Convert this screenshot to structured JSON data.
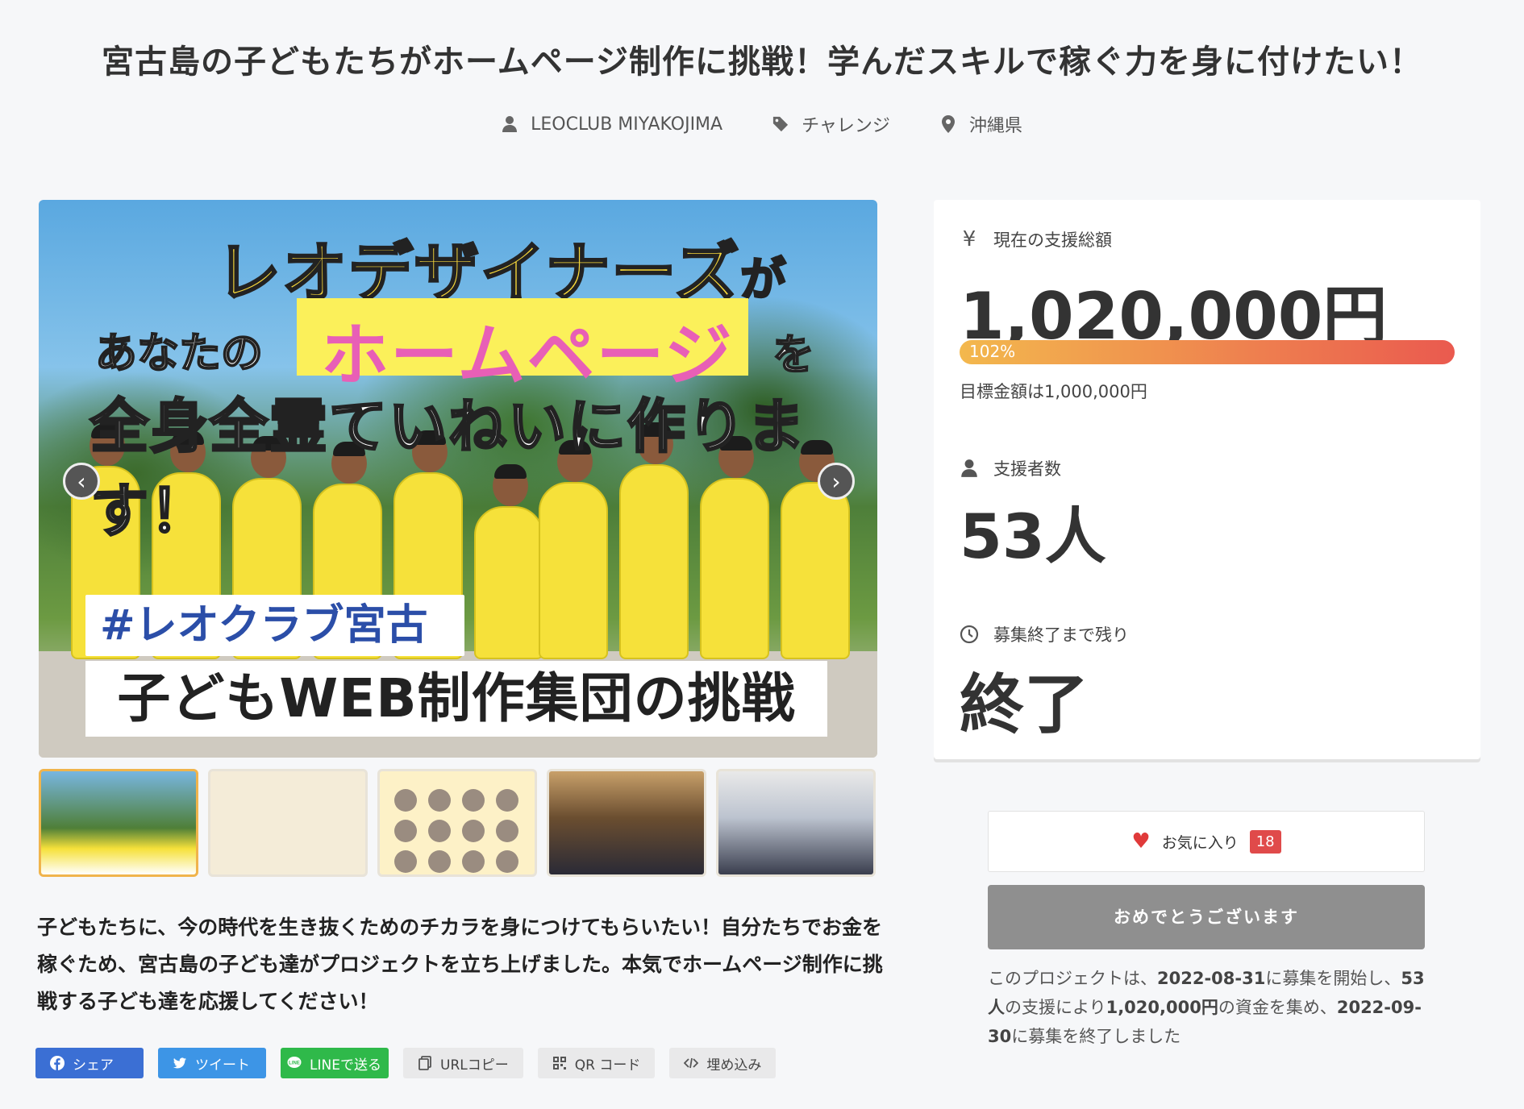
{
  "header": {
    "title": "宮古島の子どもたちがホームページ制作に挑戦！学んだスキルで稼ぐ力を身に付けたい！",
    "owner": "LEOCLUB MIYAKOJIMA",
    "category": "チャレンジ",
    "location": "沖縄県"
  },
  "hero": {
    "line1": "レオデザイナーズ",
    "line1_suffix": "が",
    "line2_prefix": "あなたの",
    "line2": "ホームページ",
    "line2_suffix": "を",
    "line3": "全身全霊ていねいに作ります！",
    "tag": "#レオクラブ宮古島",
    "band": "子どもWEB制作集団の挑戦"
  },
  "thumbnails": {
    "count": 5,
    "active_index": 0
  },
  "description": "子どもたちに、今の時代を生き抜くためのチカラを身につけてもらいたい！自分たちでお金を稼ぐため、宮古島の子ども達がプロジェクトを立ち上げました。本気でホームページ制作に挑戦する子ども達を応援してください！",
  "share": {
    "facebook": "シェア",
    "twitter": "ツイート",
    "line": "LINEで送る",
    "url_copy": "URLコピー",
    "qr": "QR コード",
    "embed": "埋め込み"
  },
  "stats": {
    "total_label": "現在の支援総額",
    "total_value": "1,020,000円",
    "progress_percent": 102,
    "progress_label": "102%",
    "goal_text": "目標金額は1,000,000円",
    "backers_label": "支援者数",
    "backers_value": "53人",
    "remaining_label": "募集終了まで残り",
    "remaining_value": "終了"
  },
  "actions": {
    "favorite_label": "お気に入り",
    "favorite_count": "18",
    "congrats_label": "おめでとうございます"
  },
  "notice": {
    "t1": "このプロジェクトは、",
    "start_date": "2022-08-31",
    "t2": "に募集を開始し、",
    "backers": "53人",
    "t3": "の支援により",
    "amount": "1,020,000円",
    "t4": "の資金を集め、",
    "end_date": "2022-09-30",
    "t5": "に募集を終了しました"
  },
  "colors": {
    "accent": "#ee7f4f",
    "favorite": "#e04a4a",
    "facebook": "#3b6fd4",
    "twitter": "#3d95e6",
    "line": "#2fb94a",
    "finished_button": "#8f8f8f"
  }
}
